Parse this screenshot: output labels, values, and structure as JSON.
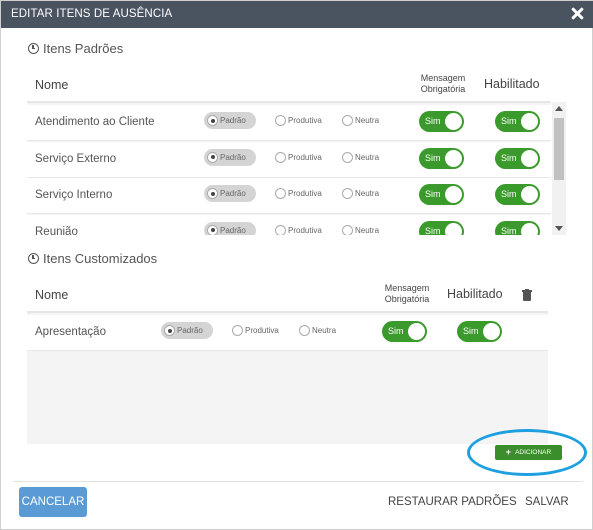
{
  "dialog": {
    "title": "EDITAR ITENS DE AUSÊNCIA"
  },
  "standard": {
    "title": "Itens Padrões",
    "col_name": "Nome",
    "col_message_line1": "Mensagem",
    "col_message_line2": "Obrigatória",
    "col_enabled": "Habilitado",
    "rows": [
      {
        "name": "Atendimento ao Cliente",
        "options": [
          "Padrão",
          "Produtiva",
          "Neutra"
        ],
        "selected": "Padrão",
        "message": "Sim",
        "enabled": "Sim"
      },
      {
        "name": "Serviço Externo",
        "options": [
          "Padrão",
          "Produtiva",
          "Neutra"
        ],
        "selected": "Padrão",
        "message": "Sim",
        "enabled": "Sim"
      },
      {
        "name": "Serviço Interno",
        "options": [
          "Padrão",
          "Produtiva",
          "Neutra"
        ],
        "selected": "Padrão",
        "message": "Sim",
        "enabled": "Sim"
      },
      {
        "name": "Reunião",
        "options": [
          "Padrão",
          "Produtiva",
          "Neutra"
        ],
        "selected": "Padrão",
        "message": "Sim",
        "enabled": "Sim"
      }
    ]
  },
  "custom": {
    "title": "Itens Customizados",
    "col_name": "Nome",
    "col_message_line1": "Mensagem",
    "col_message_line2": "Obrigatória",
    "col_enabled": "Habilitado",
    "rows": [
      {
        "name": "Apresentação",
        "options": [
          "Padrão",
          "Produtiva",
          "Neutra"
        ],
        "selected": "Padrão",
        "message": "Sim",
        "enabled": "Sim"
      }
    ],
    "add_label": "ADICIONAR"
  },
  "footer": {
    "cancel": "CANCELAR",
    "restore": "RESTAURAR PADRÕES",
    "save": "SALVAR"
  },
  "icons": {
    "close": "close-icon",
    "clock": "clock-icon",
    "trash": "trash-icon",
    "plus": "plus-icon"
  },
  "colors": {
    "titlebar": "#4a5360",
    "toggle_on": "#3a9a2b",
    "add_button": "#3a8e2b",
    "cancel_button": "#5b9bd5",
    "highlight": "#1ea0e0"
  }
}
